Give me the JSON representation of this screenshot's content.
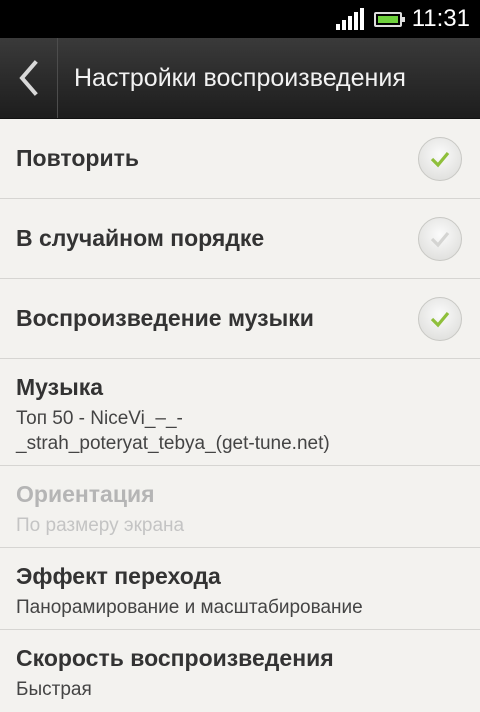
{
  "status_bar": {
    "time": "11:31",
    "icons": [
      "signal-icon",
      "battery-icon"
    ],
    "battery_color": "#6fd13d"
  },
  "header": {
    "title": "Настройки воспроизведения",
    "back_icon": "chevron-left-icon"
  },
  "settings": [
    {
      "label": "Повторить",
      "checked": true
    },
    {
      "label": "В случайном порядке",
      "checked": false
    },
    {
      "label": "Воспроизведение музыки",
      "checked": true
    }
  ],
  "music": {
    "label": "Музыка",
    "value_line1": "Топ 50 - NiceVi_–_-",
    "value_line2": "_strah_poteryat_tebya_(get-tune.net)"
  },
  "orientation": {
    "label": "Ориентация",
    "value": "По размеру экрана",
    "enabled": false
  },
  "transition": {
    "label": "Эффект перехода",
    "value": "Панорамирование и масштабирование"
  },
  "speed": {
    "label": "Скорость воспроизведения",
    "value": "Быстрая"
  },
  "colors": {
    "check_on": "#8fbf3b",
    "check_off": "#d4d4d2"
  }
}
